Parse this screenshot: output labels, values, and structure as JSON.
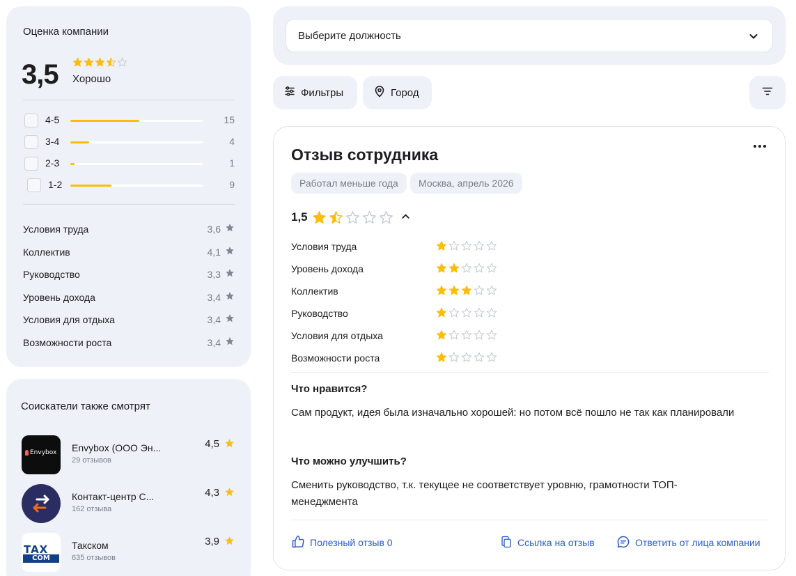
{
  "company_rating": {
    "title": "Оценка компании",
    "score": "3,5",
    "score_stars": 3.5,
    "score_word": "Хорошо",
    "distribution": [
      {
        "label": "4-5",
        "count": "15",
        "fraction": 0.52
      },
      {
        "label": "3-4",
        "count": "4",
        "fraction": 0.14
      },
      {
        "label": "2-3",
        "count": "1",
        "fraction": 0.03
      },
      {
        "label": "1-2",
        "count": "9",
        "fraction": 0.31
      }
    ],
    "categories": [
      {
        "name": "Условия труда",
        "value": "3,6"
      },
      {
        "name": "Коллектив",
        "value": "4,1"
      },
      {
        "name": "Руководство",
        "value": "3,3"
      },
      {
        "name": "Уровень дохода",
        "value": "3,4"
      },
      {
        "name": "Условия для отдыха",
        "value": "3,4"
      },
      {
        "name": "Возможности роста",
        "value": "3,4"
      }
    ]
  },
  "seekers": {
    "title": "Соискатели также смотрят",
    "items": [
      {
        "name": "Envybox (ООО Эн...",
        "reviews": "29 отзывов",
        "rating": "4,5",
        "logo_text": "Envybox",
        "logo_icon": "envybox-logo"
      },
      {
        "name": "Контакт-центр С...",
        "reviews": "162 отзыва",
        "rating": "4,3",
        "logo_icon": "arrows-exchange-logo"
      },
      {
        "name": "Такском",
        "reviews": "635 отзывов",
        "rating": "3,9",
        "logo_text_top": "TAX",
        "logo_text_bottom": "COM",
        "logo_icon": "taxcom-logo"
      }
    ]
  },
  "position_select": {
    "value": "Выберите должность"
  },
  "toolbar": {
    "filters_label": "Фильтры",
    "city_label": "Город"
  },
  "review": {
    "title": "Отзыв сотрудника",
    "tags": [
      "Работал меньше года",
      "Москва, апрель 2026"
    ],
    "score": "1,5",
    "score_stars": 1.5,
    "subratings": [
      {
        "name": "Условия труда",
        "stars": 1
      },
      {
        "name": "Уровень дохода",
        "stars": 2
      },
      {
        "name": "Коллектив",
        "stars": 3
      },
      {
        "name": "Руководство",
        "stars": 1
      },
      {
        "name": "Условия для отдыха",
        "stars": 1
      },
      {
        "name": "Возможности роста",
        "stars": 1
      }
    ],
    "likes_heading": "Что нравится?",
    "likes_text": "Сам продукт, идея была изначально хорошей: но потом всё пошло не так как планировали",
    "improve_heading": "Что можно улучшить?",
    "improve_text": "Сменить руководство, т.к. текущее не соответствует уровню, грамотности ТОП-менеджмента",
    "actions": {
      "useful": "Полезный отзыв 0",
      "link": "Ссылка на отзыв",
      "reply": "Ответить от лица компании"
    }
  },
  "colors": {
    "star": "#fbbd0c",
    "star_empty": "#c3c7cf",
    "accent_link": "#2a5cc9",
    "panel_bg": "#eef1f7"
  }
}
